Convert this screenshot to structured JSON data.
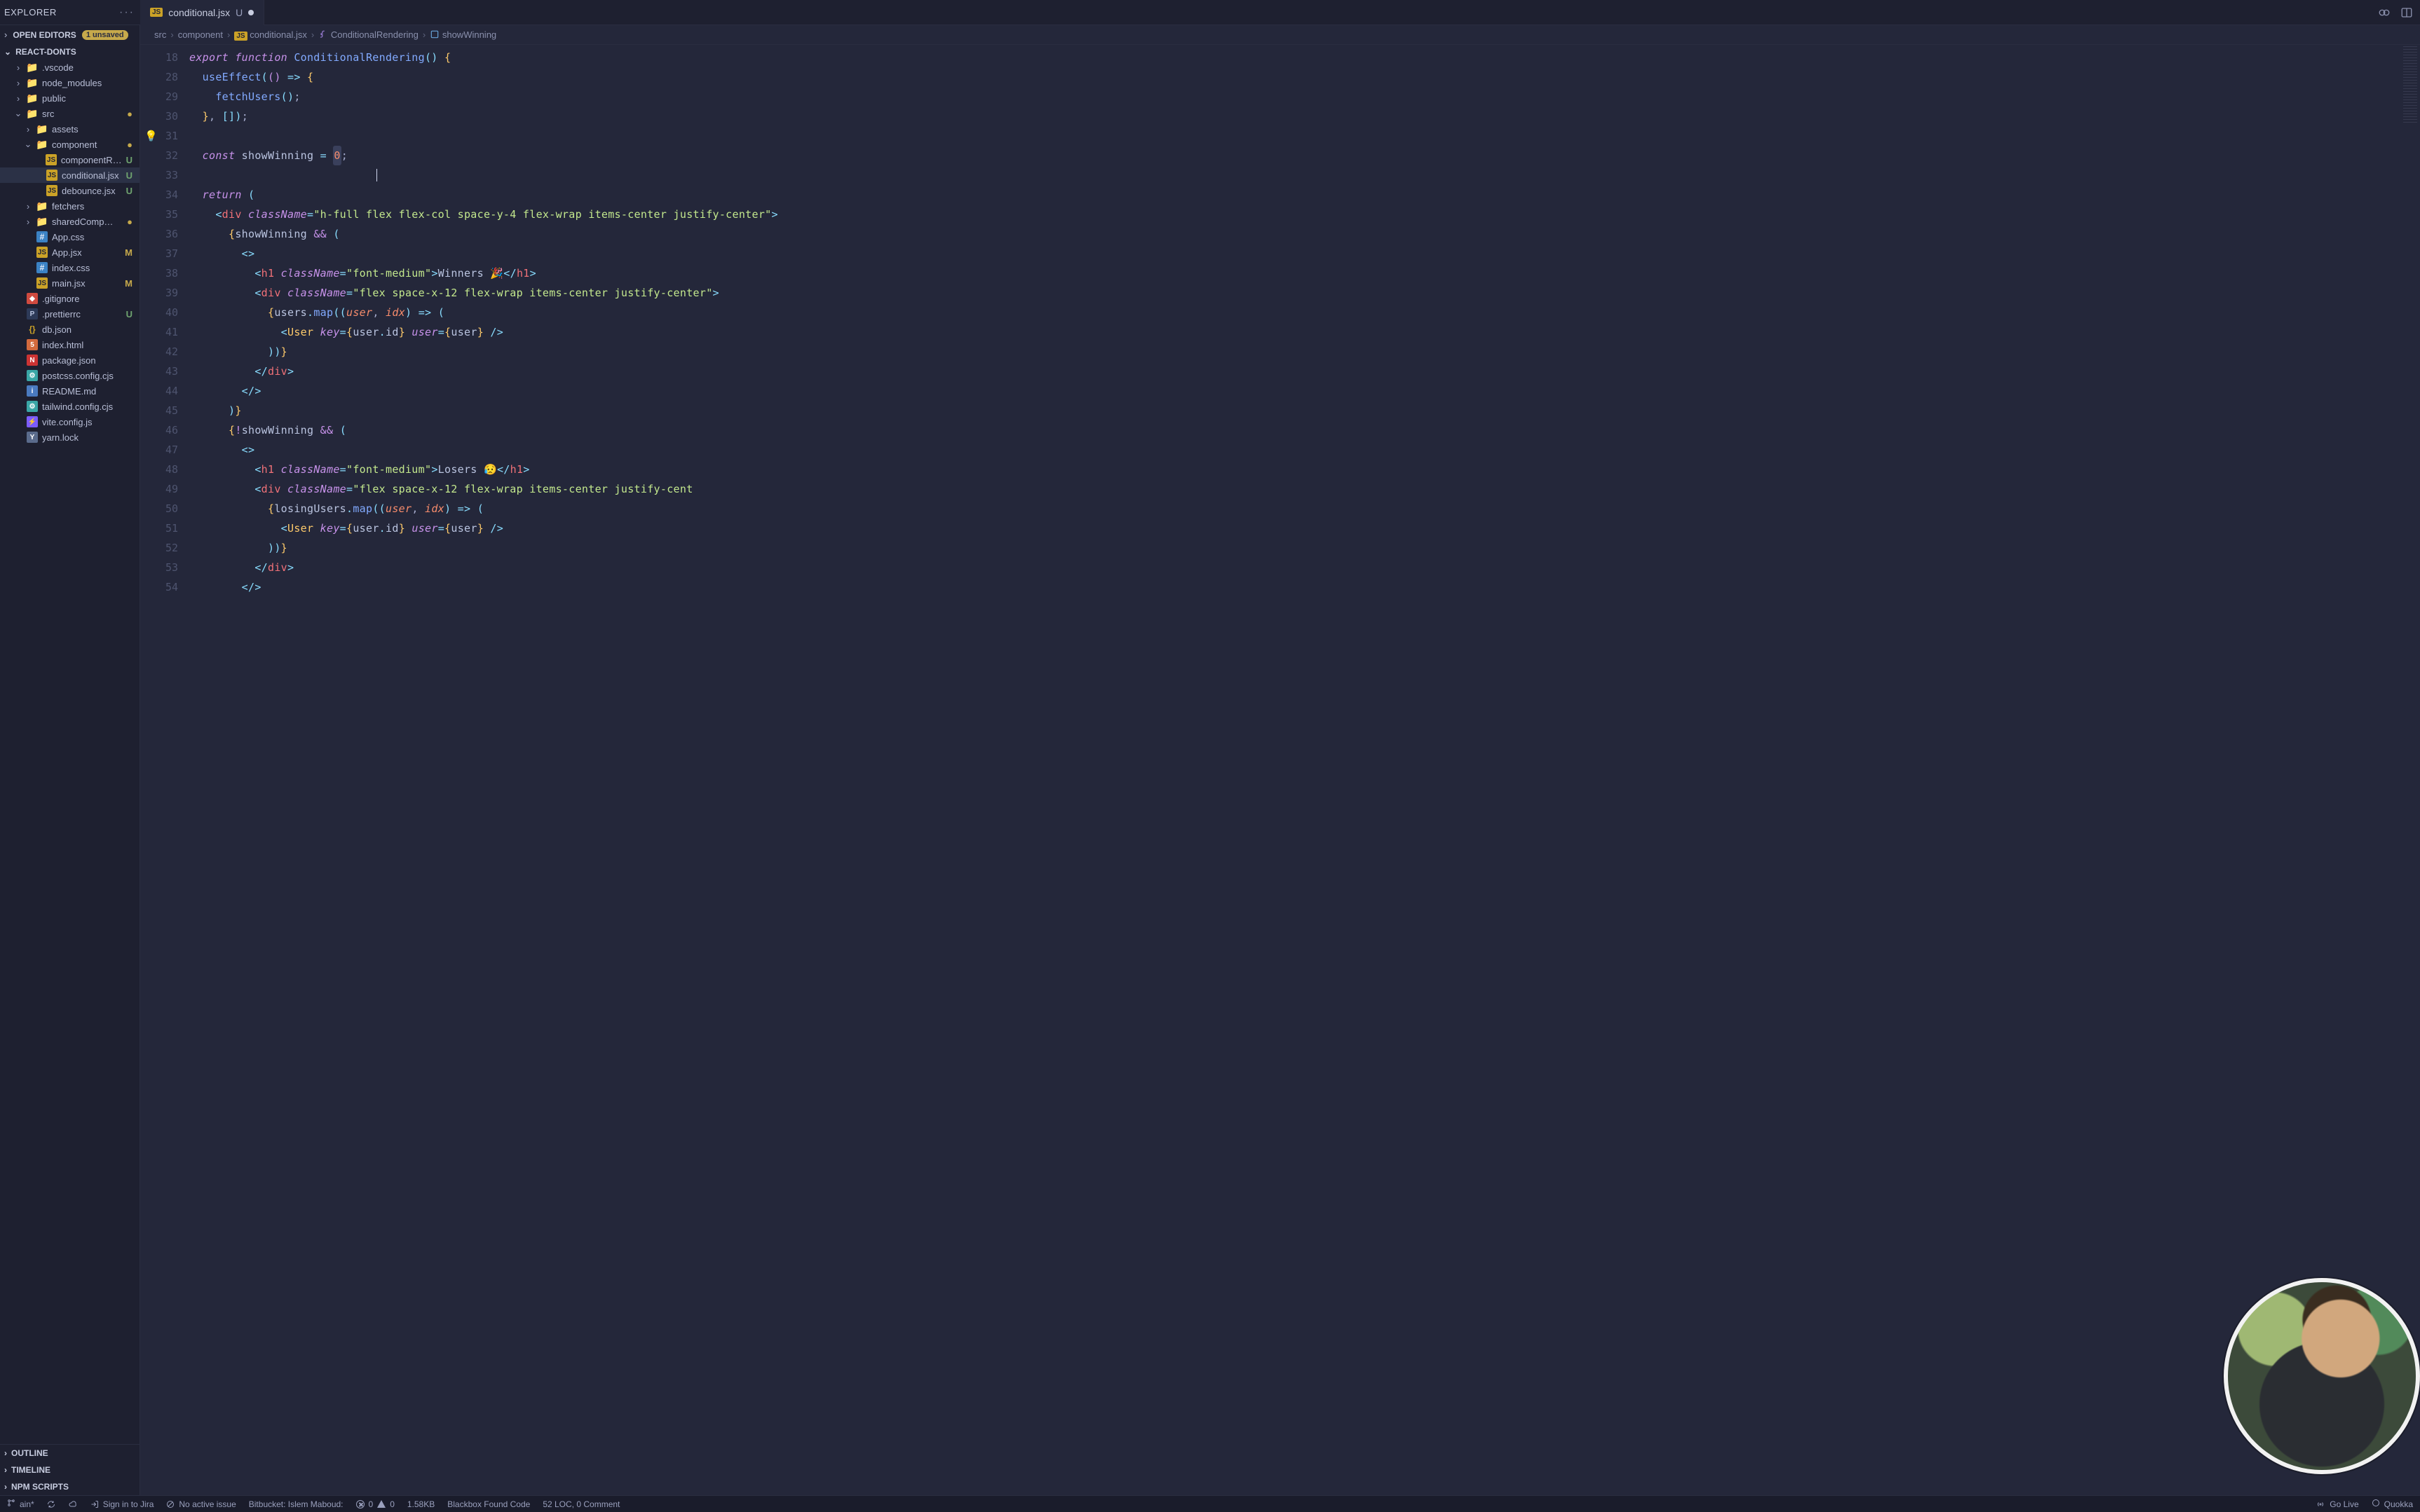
{
  "tabbar": {
    "explorer_label": "EXPLORER",
    "tab": {
      "filename": "conditional.jsx",
      "status": "U"
    }
  },
  "sidebar": {
    "open_editors_label": "OPEN EDITORS",
    "unsaved_badge": "1 unsaved",
    "project_name": "REACT-DONTS",
    "tree": [
      {
        "kind": "folder",
        "name": ".vscode",
        "indent": 1,
        "chev": "›",
        "icon": "folder"
      },
      {
        "kind": "folder",
        "name": "node_modules",
        "indent": 1,
        "chev": "›",
        "icon": "folder"
      },
      {
        "kind": "folder",
        "name": "public",
        "indent": 1,
        "chev": "›",
        "icon": "folder"
      },
      {
        "kind": "folder",
        "name": "src",
        "indent": 1,
        "chev": "⌄",
        "icon": "folder",
        "status": "dot"
      },
      {
        "kind": "folder",
        "name": "assets",
        "indent": 2,
        "chev": "›",
        "icon": "folder"
      },
      {
        "kind": "folder",
        "name": "component",
        "indent": 2,
        "chev": "⌄",
        "icon": "folder",
        "status": "dot"
      },
      {
        "kind": "file",
        "name": "componentR…",
        "indent": 3,
        "icon": "js",
        "status": "U"
      },
      {
        "kind": "file",
        "name": "conditional.jsx",
        "indent": 3,
        "icon": "js",
        "status": "U",
        "selected": true
      },
      {
        "kind": "file",
        "name": "debounce.jsx",
        "indent": 3,
        "icon": "js",
        "status": "U"
      },
      {
        "kind": "folder",
        "name": "fetchers",
        "indent": 2,
        "chev": "›",
        "icon": "folder"
      },
      {
        "kind": "folder",
        "name": "sharedComp…",
        "indent": 2,
        "chev": "›",
        "icon": "folder",
        "status": "dot"
      },
      {
        "kind": "file",
        "name": "App.css",
        "indent": 2,
        "icon": "css"
      },
      {
        "kind": "file",
        "name": "App.jsx",
        "indent": 2,
        "icon": "js",
        "status": "M"
      },
      {
        "kind": "file",
        "name": "index.css",
        "indent": 2,
        "icon": "css"
      },
      {
        "kind": "file",
        "name": "main.jsx",
        "indent": 2,
        "icon": "js",
        "status": "M"
      },
      {
        "kind": "file",
        "name": ".gitignore",
        "indent": 1,
        "icon": "git"
      },
      {
        "kind": "file",
        "name": ".prettierrc",
        "indent": 1,
        "icon": "pret",
        "status": "U"
      },
      {
        "kind": "file",
        "name": "db.json",
        "indent": 1,
        "icon": "json"
      },
      {
        "kind": "file",
        "name": "index.html",
        "indent": 1,
        "icon": "html"
      },
      {
        "kind": "file",
        "name": "package.json",
        "indent": 1,
        "icon": "npm"
      },
      {
        "kind": "file",
        "name": "postcss.config.cjs",
        "indent": 1,
        "icon": "cfg"
      },
      {
        "kind": "file",
        "name": "README.md",
        "indent": 1,
        "icon": "md"
      },
      {
        "kind": "file",
        "name": "tailwind.config.cjs",
        "indent": 1,
        "icon": "cfg"
      },
      {
        "kind": "file",
        "name": "vite.config.js",
        "indent": 1,
        "icon": "vite"
      },
      {
        "kind": "file",
        "name": "yarn.lock",
        "indent": 1,
        "icon": "yarn"
      }
    ],
    "panels": [
      {
        "label": "OUTLINE"
      },
      {
        "label": "TIMELINE"
      },
      {
        "label": "NPM SCRIPTS"
      }
    ]
  },
  "breadcrumb": {
    "segments": [
      {
        "text": "src"
      },
      {
        "text": "component"
      },
      {
        "text": "conditional.jsx",
        "js": true
      },
      {
        "text": "ConditionalRendering",
        "sym": "fn"
      },
      {
        "text": "showWinning",
        "sym": "var"
      }
    ]
  },
  "code": {
    "line_numbers": [
      18,
      28,
      29,
      30,
      31,
      32,
      33,
      34,
      35,
      36,
      37,
      38,
      39,
      40,
      41,
      42,
      43,
      44,
      45,
      46,
      47,
      48,
      49,
      50,
      51,
      52,
      53,
      54
    ],
    "bulb_line_index": 4,
    "cursor": {
      "line_index": 6,
      "col": 29
    },
    "lines": [
      [
        [
          "kw",
          "export "
        ],
        [
          "kw",
          "function "
        ],
        [
          "fn",
          "ConditionalRendering"
        ],
        [
          "op",
          "()"
        ],
        [
          "pnc",
          " "
        ],
        [
          "brc",
          "{"
        ]
      ],
      [
        [
          "pnc",
          "  "
        ],
        [
          "fn",
          "useEffect"
        ],
        [
          "op",
          "("
        ],
        [
          "brp",
          "()"
        ],
        [
          "pnc",
          " "
        ],
        [
          "op",
          "=>"
        ],
        [
          "pnc",
          " "
        ],
        [
          "brc",
          "{"
        ]
      ],
      [
        [
          "pnc",
          "    "
        ],
        [
          "fn",
          "fetchUsers"
        ],
        [
          "op",
          "()"
        ],
        [
          "pnc",
          ";"
        ]
      ],
      [
        [
          "pnc",
          "  "
        ],
        [
          "brc",
          "}"
        ],
        [
          "pnc",
          ", "
        ],
        [
          "op",
          "["
        ],
        [
          "op",
          "]"
        ],
        [
          "op",
          ")"
        ],
        [
          "pnc",
          ";"
        ]
      ],
      [
        [
          "pnc",
          " "
        ]
      ],
      [
        [
          "pnc",
          "  "
        ],
        [
          "kw",
          "const "
        ],
        [
          "var",
          "showWinning"
        ],
        [
          "pnc",
          " "
        ],
        [
          "op",
          "="
        ],
        [
          "pnc",
          " "
        ],
        [
          "num hlnum",
          "0"
        ],
        [
          "pnc",
          ";"
        ]
      ],
      [
        [
          "pnc",
          " "
        ]
      ],
      [
        [
          "pnc",
          "  "
        ],
        [
          "kw",
          "return "
        ],
        [
          "op",
          "("
        ]
      ],
      [
        [
          "pnc",
          "    "
        ],
        [
          "jsxp",
          "<"
        ],
        [
          "tag",
          "div"
        ],
        [
          "pnc",
          " "
        ],
        [
          "attr",
          "className"
        ],
        [
          "op",
          "="
        ],
        [
          "str",
          "\"h-full flex flex-col space-y-4 flex-wrap items-center justify-center\""
        ],
        [
          "jsxp",
          ">"
        ]
      ],
      [
        [
          "pnc",
          "      "
        ],
        [
          "brc",
          "{"
        ],
        [
          "var",
          "showWinning"
        ],
        [
          "pnc",
          " "
        ],
        [
          "kw2",
          "&&"
        ],
        [
          "pnc",
          " "
        ],
        [
          "op",
          "("
        ]
      ],
      [
        [
          "pnc",
          "        "
        ],
        [
          "jsxp",
          "<>"
        ]
      ],
      [
        [
          "pnc",
          "          "
        ],
        [
          "jsxp",
          "<"
        ],
        [
          "tag",
          "h1"
        ],
        [
          "pnc",
          " "
        ],
        [
          "attr",
          "className"
        ],
        [
          "op",
          "="
        ],
        [
          "str",
          "\"font-medium\""
        ],
        [
          "jsxp",
          ">"
        ],
        [
          "txt",
          "Winners 🎉"
        ],
        [
          "jsxp",
          "</"
        ],
        [
          "tag",
          "h1"
        ],
        [
          "jsxp",
          ">"
        ]
      ],
      [
        [
          "pnc",
          "          "
        ],
        [
          "jsxp",
          "<"
        ],
        [
          "tag",
          "div"
        ],
        [
          "pnc",
          " "
        ],
        [
          "attr",
          "className"
        ],
        [
          "op",
          "="
        ],
        [
          "str",
          "\"flex space-x-12 flex-wrap items-center justify-center\""
        ],
        [
          "jsxp",
          ">"
        ]
      ],
      [
        [
          "pnc",
          "            "
        ],
        [
          "brc",
          "{"
        ],
        [
          "var",
          "users"
        ],
        [
          "dot",
          "."
        ],
        [
          "fn2",
          "map"
        ],
        [
          "op",
          "(("
        ],
        [
          "arg",
          "user"
        ],
        [
          "pnc",
          ", "
        ],
        [
          "arg",
          "idx"
        ],
        [
          "op",
          ")"
        ],
        [
          "pnc",
          " "
        ],
        [
          "op",
          "=>"
        ],
        [
          "pnc",
          " "
        ],
        [
          "op",
          "("
        ]
      ],
      [
        [
          "pnc",
          "              "
        ],
        [
          "jsxp",
          "<"
        ],
        [
          "comp",
          "User"
        ],
        [
          "pnc",
          " "
        ],
        [
          "attr",
          "key"
        ],
        [
          "op",
          "="
        ],
        [
          "brc",
          "{"
        ],
        [
          "var",
          "user"
        ],
        [
          "dot",
          "."
        ],
        [
          "var",
          "id"
        ],
        [
          "brc",
          "}"
        ],
        [
          "pnc",
          " "
        ],
        [
          "attr",
          "user"
        ],
        [
          "op",
          "="
        ],
        [
          "brc",
          "{"
        ],
        [
          "var",
          "user"
        ],
        [
          "brc",
          "}"
        ],
        [
          "pnc",
          " "
        ],
        [
          "jsxp",
          "/>"
        ]
      ],
      [
        [
          "pnc",
          "            "
        ],
        [
          "op",
          "))"
        ],
        [
          "brc",
          "}"
        ]
      ],
      [
        [
          "pnc",
          "          "
        ],
        [
          "jsxp",
          "</"
        ],
        [
          "tag",
          "div"
        ],
        [
          "jsxp",
          ">"
        ]
      ],
      [
        [
          "pnc",
          "        "
        ],
        [
          "jsxp",
          "</>"
        ]
      ],
      [
        [
          "pnc",
          "      "
        ],
        [
          "op",
          ")"
        ],
        [
          "brc",
          "}"
        ]
      ],
      [
        [
          "pnc",
          "      "
        ],
        [
          "brc",
          "{"
        ],
        [
          "kw2",
          "!"
        ],
        [
          "var",
          "showWinning"
        ],
        [
          "pnc",
          " "
        ],
        [
          "kw2",
          "&&"
        ],
        [
          "pnc",
          " "
        ],
        [
          "op",
          "("
        ]
      ],
      [
        [
          "pnc",
          "        "
        ],
        [
          "jsxp",
          "<>"
        ]
      ],
      [
        [
          "pnc",
          "          "
        ],
        [
          "jsxp",
          "<"
        ],
        [
          "tag",
          "h1"
        ],
        [
          "pnc",
          " "
        ],
        [
          "attr",
          "className"
        ],
        [
          "op",
          "="
        ],
        [
          "str",
          "\"font-medium\""
        ],
        [
          "jsxp",
          ">"
        ],
        [
          "txt",
          "Losers 😥"
        ],
        [
          "jsxp",
          "</"
        ],
        [
          "tag",
          "h1"
        ],
        [
          "jsxp",
          ">"
        ]
      ],
      [
        [
          "pnc",
          "          "
        ],
        [
          "jsxp",
          "<"
        ],
        [
          "tag",
          "div"
        ],
        [
          "pnc",
          " "
        ],
        [
          "attr",
          "className"
        ],
        [
          "op",
          "="
        ],
        [
          "str",
          "\"flex space-x-12 flex-wrap items-center justify-cent"
        ]
      ],
      [
        [
          "pnc",
          "            "
        ],
        [
          "brc",
          "{"
        ],
        [
          "var",
          "losingUsers"
        ],
        [
          "dot",
          "."
        ],
        [
          "fn2",
          "map"
        ],
        [
          "op",
          "(("
        ],
        [
          "arg",
          "user"
        ],
        [
          "pnc",
          ", "
        ],
        [
          "arg",
          "idx"
        ],
        [
          "op",
          ")"
        ],
        [
          "pnc",
          " "
        ],
        [
          "op",
          "=>"
        ],
        [
          "pnc",
          " "
        ],
        [
          "op",
          "("
        ]
      ],
      [
        [
          "pnc",
          "              "
        ],
        [
          "jsxp",
          "<"
        ],
        [
          "comp",
          "User"
        ],
        [
          "pnc",
          " "
        ],
        [
          "attr",
          "key"
        ],
        [
          "op",
          "="
        ],
        [
          "brc",
          "{"
        ],
        [
          "var",
          "user"
        ],
        [
          "dot",
          "."
        ],
        [
          "var",
          "id"
        ],
        [
          "brc",
          "}"
        ],
        [
          "pnc",
          " "
        ],
        [
          "attr",
          "user"
        ],
        [
          "op",
          "="
        ],
        [
          "brc",
          "{"
        ],
        [
          "var",
          "user"
        ],
        [
          "brc",
          "}"
        ],
        [
          "pnc",
          " "
        ],
        [
          "jsxp",
          "/>"
        ]
      ],
      [
        [
          "pnc",
          "            "
        ],
        [
          "op",
          "))"
        ],
        [
          "brc",
          "}"
        ]
      ],
      [
        [
          "pnc",
          "          "
        ],
        [
          "jsxp",
          "</"
        ],
        [
          "tag",
          "div"
        ],
        [
          "jsxp",
          ">"
        ]
      ],
      [
        [
          "pnc",
          "        "
        ],
        [
          "jsxp",
          "</>"
        ]
      ]
    ]
  },
  "statusbar": {
    "branch": "ain*",
    "jira_signin": "Sign in to Jira",
    "no_issue": "No active issue",
    "bitbucket": "Bitbucket: Islem Maboud:",
    "errors": "0",
    "warnings": "0",
    "filesize": "1.58KB",
    "blackbox": "Blackbox Found Code",
    "loc": "52 LOC, 0 Comment",
    "golive": "Go Live",
    "quokka": "Quokka"
  }
}
